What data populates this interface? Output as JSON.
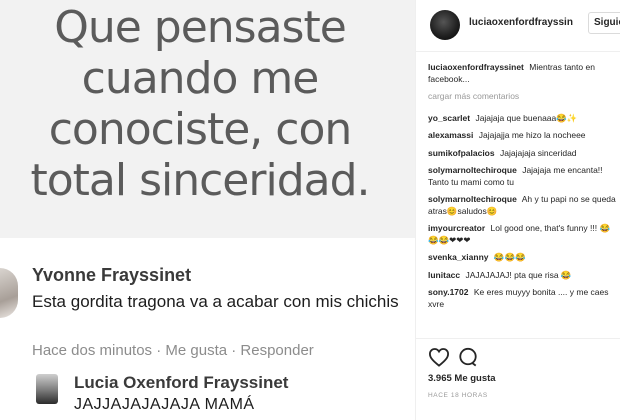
{
  "post_image": {
    "quote_lines": [
      "Que pensaste",
      "cuando me",
      "conociste, con",
      "total sinceridad."
    ],
    "fb_comment_1": {
      "name": "Yvonne Frayssinet",
      "text": "Esta gordita tragona va a acabar con mis chichis",
      "meta": "Hace dos minutos · Me gusta · Responder"
    },
    "fb_comment_2": {
      "name": "Lucia Oxenford Frayssinet",
      "text": "JAJJAJAJAJAJA MAMÁ"
    }
  },
  "header": {
    "username": "luciaoxenfordfrayssin",
    "follow_label": "Siguie"
  },
  "caption": {
    "user": "luciaoxenfordfrayssinet",
    "text": "Mientras tanto en facebook..."
  },
  "load_more": "cargar más comentarios",
  "comments": [
    {
      "user": "yo_scarlet",
      "text": "Jajajaja que buenaaa😂✨"
    },
    {
      "user": "alexamassi",
      "text": "Jajajajja me hizo la nocheee"
    },
    {
      "user": "sumikofpalacios",
      "text": "Jajajajaja sinceridad"
    },
    {
      "user": "solymarnoltechiroque",
      "text": "Jajajaja me encanta!! Tanto tu mami como tu"
    },
    {
      "user": "solymarnoltechiroque",
      "text": "Ah y tu papi no se queda atras😊saludos😊"
    },
    {
      "user": "imyourcreator",
      "text": "Lol good one, that's funny !!! 😂😂😂❤❤❤"
    },
    {
      "user": "svenka_xianny",
      "text": "😂😂😂"
    },
    {
      "user": "lunitacc",
      "text": "JAJAJAJAJ! pta que risa 😂"
    },
    {
      "user": "sony.1702",
      "text": "Ke eres muyyy bonita .... y me caes xvre"
    }
  ],
  "likes": "3.965 Me gusta",
  "timestamp": "HACE 18 HORAS",
  "colors": {
    "text": "#262626",
    "muted": "#999999",
    "border": "#efefef"
  },
  "icons": {
    "like": "heart-icon",
    "comment": "comment-icon"
  }
}
